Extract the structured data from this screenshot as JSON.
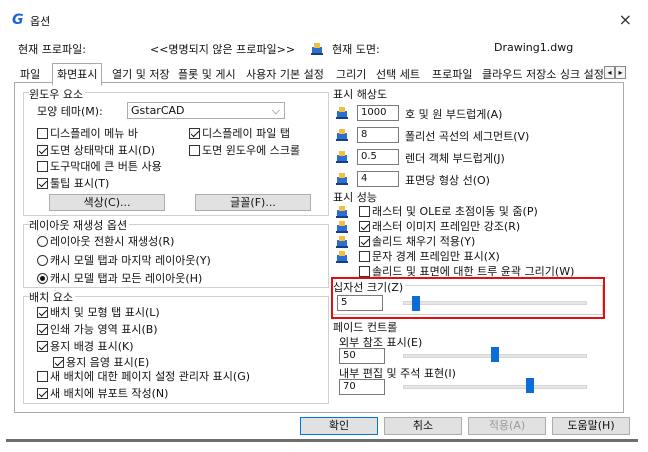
{
  "window": {
    "title": "옵션",
    "close_glyph": "×"
  },
  "profile": {
    "current_profile_label": "현재 프로파일:",
    "current_profile_value": "<<명명되지 않은 프로파일>>",
    "current_drawing_label": "현재 도면:",
    "current_drawing_value": "Drawing1.dwg"
  },
  "tabs": [
    "파일",
    "화면표시",
    "열기 및 저장",
    "플롯 및 게시",
    "사용자 기본 설정",
    "그리기",
    "선택 세트",
    "프로파일",
    "클라우드 저장소 싱크 설정"
  ],
  "active_tab": "화면표시",
  "window_elements": {
    "title": "윈도우 요소",
    "theme_label": "모양 테마(M):",
    "theme_value": "GstarCAD",
    "checkboxes": [
      {
        "label": "디스플레이 메뉴 바",
        "checked": false
      },
      {
        "label": "디스플레이 파일 탭",
        "checked": true
      },
      {
        "label": "도면 상태막대 표시(D)",
        "checked": true
      },
      {
        "label": "도면 윈도우에 스크롤",
        "checked": false
      },
      {
        "label": "도구막대에 큰 버튼 사용",
        "checked": false
      },
      {
        "label": "툴팁 표시(T)",
        "checked": true
      }
    ],
    "color_button": "색상(C)...",
    "font_button": "글꼴(F)..."
  },
  "layout_regen": {
    "title": "레이아웃 재생성 옵션",
    "options": [
      {
        "label": "레이아웃 전환시 재생성(R)",
        "selected": false
      },
      {
        "label": "캐시 모델 탭과 마지막 레이아웃(Y)",
        "selected": false
      },
      {
        "label": "캐시 모델 탭과 모든 레이아웃(H)",
        "selected": true
      }
    ]
  },
  "layout_elements": {
    "title": "배치 요소",
    "checkboxes": [
      {
        "label": "배치 및 모형 탭 표시(L)",
        "checked": true
      },
      {
        "label": "인쇄 가능 영역 표시(B)",
        "checked": true
      },
      {
        "label": "용지 배경 표시(K)",
        "checked": true
      },
      {
        "label": "용지 음영 표시(E)",
        "checked": true
      },
      {
        "label": "새 배치에 대한 페이지 설정 관리자 표시(G)",
        "checked": false
      },
      {
        "label": "새 배치에 뷰포트 작성(N)",
        "checked": true
      }
    ]
  },
  "resolution": {
    "title": "표시 해상도",
    "rows": [
      {
        "value": "1000",
        "label": "호 및 원 부드럽게(A)"
      },
      {
        "value": "8",
        "label": "폴리선 곡선의 세그먼트(V)"
      },
      {
        "value": "0.5",
        "label": "렌더 객체 부드럽게(J)"
      },
      {
        "value": "4",
        "label": "표면당 형상 선(O)"
      }
    ]
  },
  "performance": {
    "title": "표시 성능",
    "checkboxes": [
      {
        "label": "래스터 및 OLE로 초점이동 및 줌(P)",
        "checked": false
      },
      {
        "label": "래스터 이미지 프레임만 강조(R)",
        "checked": true
      },
      {
        "label": "솔리드 채우기 적용(Y)",
        "checked": true
      },
      {
        "label": "문자 경계 프레임만 표시(X)",
        "checked": false
      },
      {
        "label": "솔리드 및 표면에 대한 트루 윤곽 그리기(W)",
        "checked": false
      }
    ]
  },
  "crosshair": {
    "title": "십자선 크기(Z)",
    "value": "5",
    "level_percent": 5
  },
  "fade": {
    "title": "페이드 컨트롤",
    "xref_label": "외부 참조 표시(E)",
    "xref_value": "50",
    "xref_level_percent": 50,
    "inplace_label": "내부 편집 및 주석 표현(I)",
    "inplace_value": "70",
    "inplace_level_percent": 70
  },
  "footer": {
    "ok": "확인",
    "cancel": "취소",
    "apply": "적용(A)",
    "help": "도움말(H)"
  },
  "colors": {
    "accent": "#0a6ed6",
    "highlight": "#e01010"
  }
}
